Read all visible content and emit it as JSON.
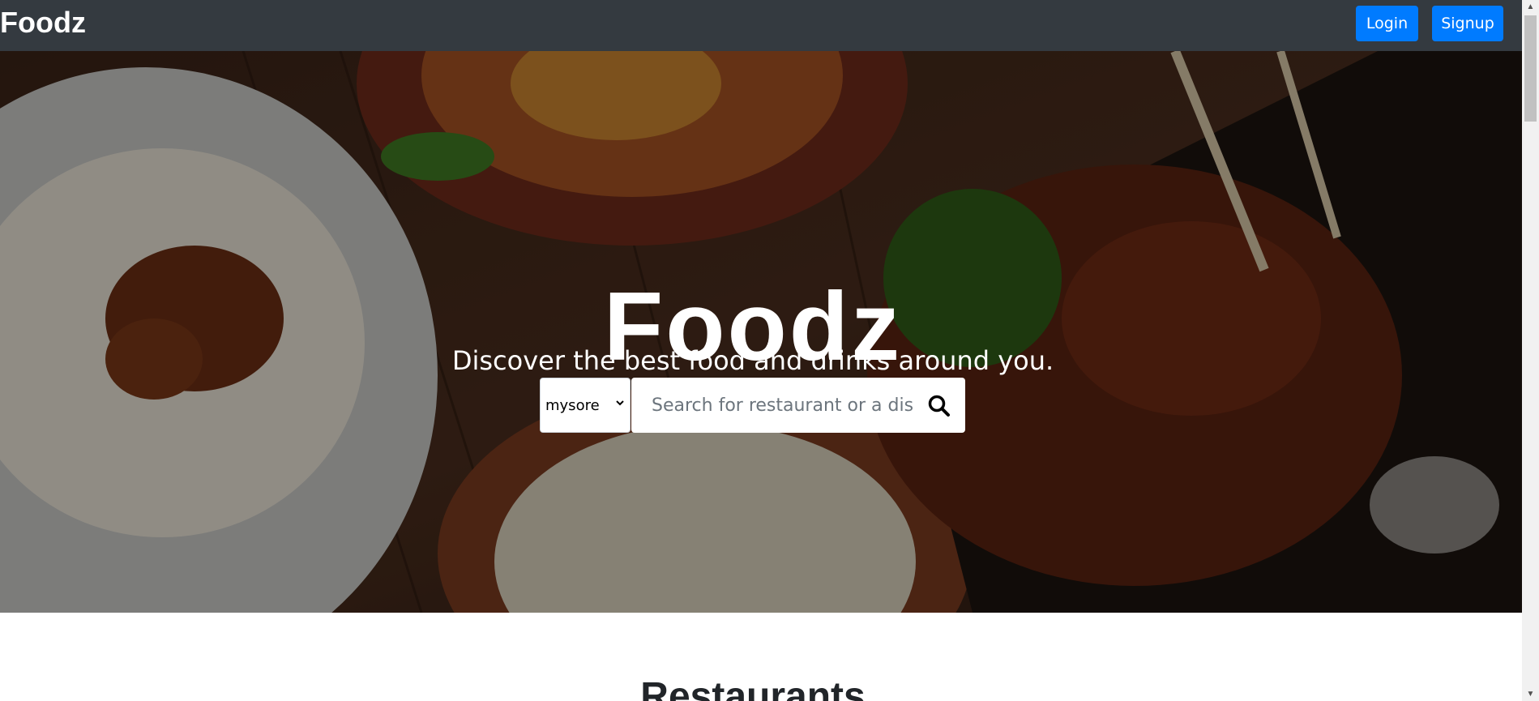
{
  "navbar": {
    "brand": "Foodz",
    "login_label": "Login",
    "signup_label": "Signup"
  },
  "hero": {
    "title": "Foodz",
    "subtitle": "Discover the best food and drinks around you.",
    "city_select": {
      "selected": "mysore"
    },
    "search": {
      "placeholder": "Search for restaurant or a dish",
      "value": ""
    }
  },
  "section": {
    "title": "Restaurants"
  },
  "colors": {
    "navbar_bg": "#343a40",
    "button_primary": "#007bff",
    "heading_text": "#212529"
  },
  "icons": {
    "search": "search-icon",
    "select": "chevron-down-icon"
  }
}
